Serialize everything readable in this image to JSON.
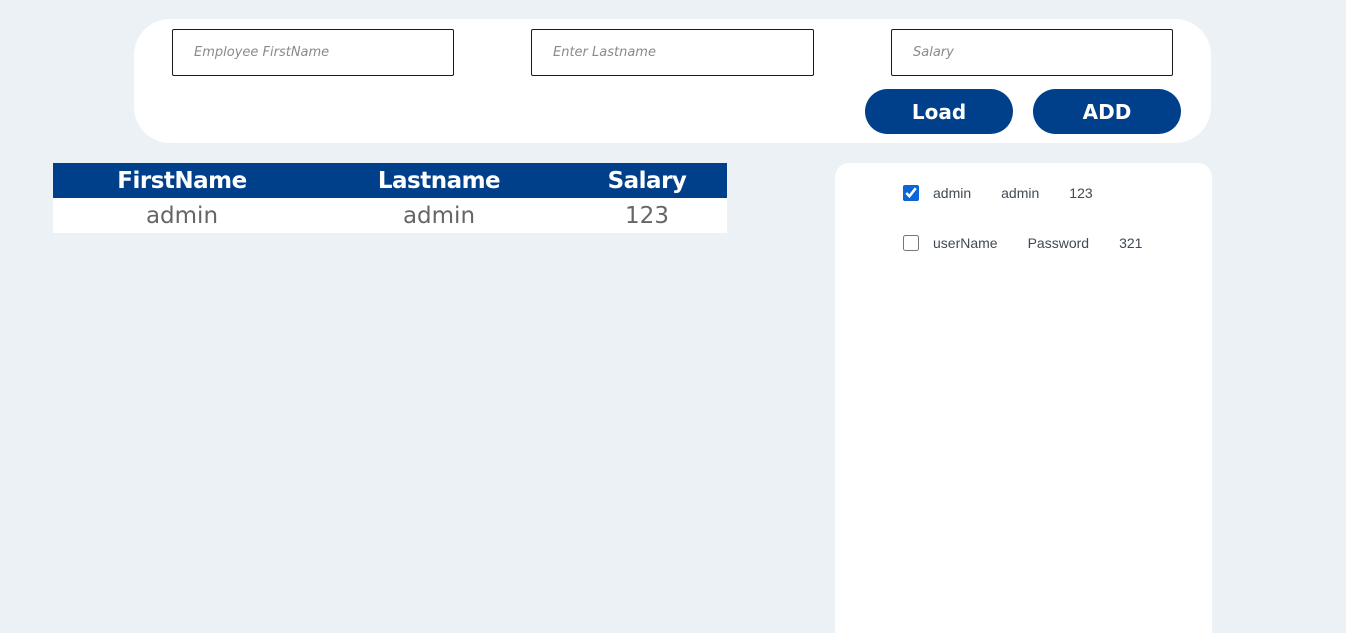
{
  "form": {
    "first_placeholder": "Employee FirstName",
    "last_placeholder": "Enter Lastname",
    "salary_placeholder": "Salary",
    "load_label": "Load",
    "add_label": "ADD"
  },
  "table": {
    "headers": [
      "FirstName",
      "Lastname",
      "Salary"
    ],
    "rows": [
      [
        "admin",
        "admin",
        "123"
      ]
    ]
  },
  "side_list": {
    "items": [
      {
        "checked": true,
        "first": "admin",
        "last": "admin",
        "salary": "123"
      },
      {
        "checked": false,
        "first": "userName",
        "last": "Password",
        "salary": "321"
      }
    ]
  },
  "colors": {
    "accent": "#003f8a",
    "background": "#ebf1f4",
    "checkbox": "#0a66d6"
  }
}
